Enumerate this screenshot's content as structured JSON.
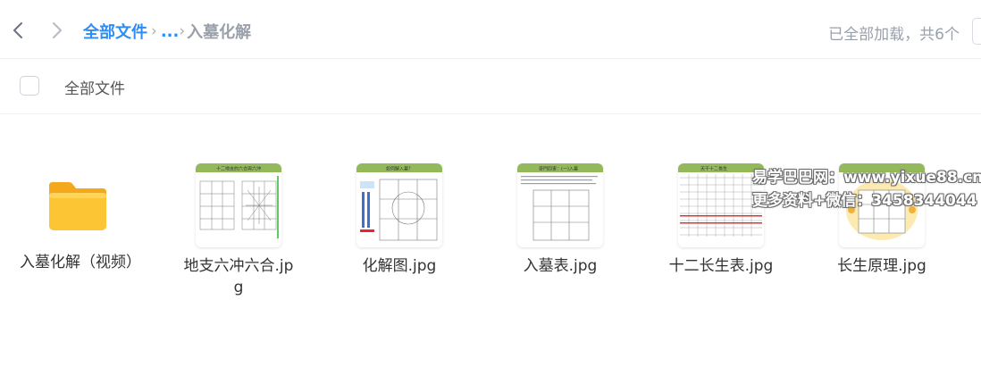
{
  "breadcrumb": {
    "root": "全部文件",
    "ellipsis": "...",
    "current": "入墓化解"
  },
  "status_text": "已全部加载，共6个",
  "select_all_label": "全部文件",
  "items": [
    {
      "name": "入墓化解（视频）",
      "type": "folder",
      "icon": "folder-icon"
    },
    {
      "name": "地支六冲六合.jpg",
      "type": "image",
      "thumb_title": "十二地支的六合與六沖"
    },
    {
      "name": "化解图.jpg",
      "type": "image",
      "thumb_title": "如何解入墓？"
    },
    {
      "name": "入墓表.jpg",
      "type": "image",
      "thumb_title": "奇門四害：(一)入墓"
    },
    {
      "name": "十二长生表.jpg",
      "type": "image",
      "thumb_title": "天干十二長生"
    },
    {
      "name": "长生原理.jpg",
      "type": "image",
      "thumb_title": ""
    }
  ],
  "watermark": {
    "line1": "易学巴巴网：www.yixue88.cn",
    "line2": "更多资料+微信：3458344044"
  },
  "colors": {
    "accent": "#2b8df5",
    "folder": "#fcc533",
    "thumb_header": "#93b95a"
  }
}
